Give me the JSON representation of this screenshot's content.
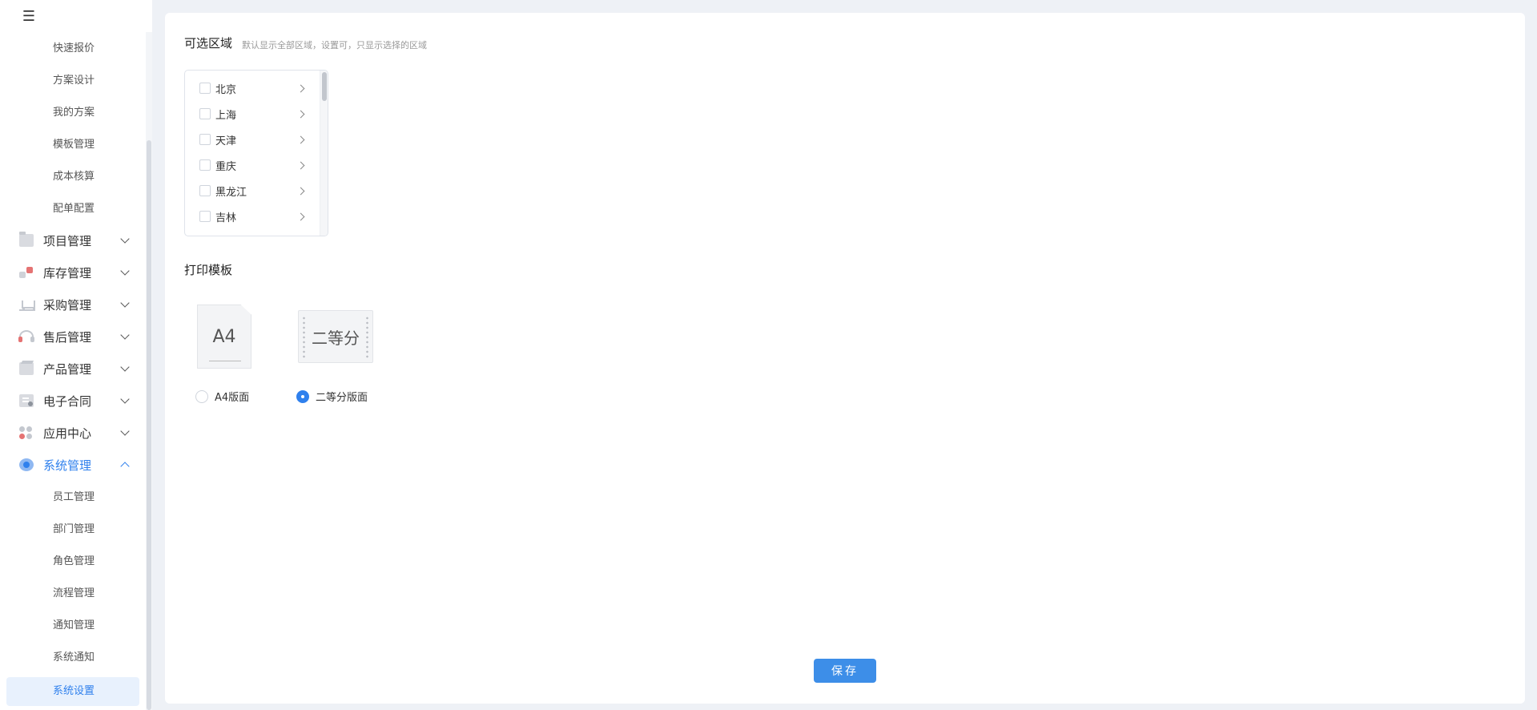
{
  "sidebar": {
    "toggle_icon": "menu-fold-icon",
    "top_submenu": [
      "快速报价",
      "方案设计",
      "我的方案",
      "模板管理",
      "成本核算",
      "配单配置"
    ],
    "groups": [
      {
        "label": "项目管理",
        "icon": "folder-icon"
      },
      {
        "label": "库存管理",
        "icon": "warehouse-icon"
      },
      {
        "label": "采购管理",
        "icon": "cart-icon"
      },
      {
        "label": "售后管理",
        "icon": "headset-icon"
      },
      {
        "label": "产品管理",
        "icon": "box-icon"
      },
      {
        "label": "电子合同",
        "icon": "contract-icon"
      },
      {
        "label": "应用中心",
        "icon": "apps-icon"
      },
      {
        "label": "系统管理",
        "icon": "system-icon",
        "expanded": true
      }
    ],
    "system_submenu": [
      "员工管理",
      "部门管理",
      "角色管理",
      "流程管理",
      "通知管理",
      "系统通知",
      "系统设置"
    ],
    "active_item": "系统设置"
  },
  "region": {
    "title": "可选区域",
    "hint": "默认显示全部区域，设置可，只显示选择的区域",
    "items": [
      "北京",
      "上海",
      "天津",
      "重庆",
      "黑龙江",
      "吉林"
    ]
  },
  "print_template": {
    "title": "打印模板",
    "options": [
      {
        "thumb": "A4",
        "label": "A4版面",
        "checked": false
      },
      {
        "thumb": "二等分",
        "label": "二等分版面",
        "checked": true
      }
    ]
  },
  "actions": {
    "save_label": "保存"
  },
  "colors": {
    "accent": "#2f80ed",
    "background": "#eef1f6",
    "active_bg": "#e8f1fd"
  }
}
